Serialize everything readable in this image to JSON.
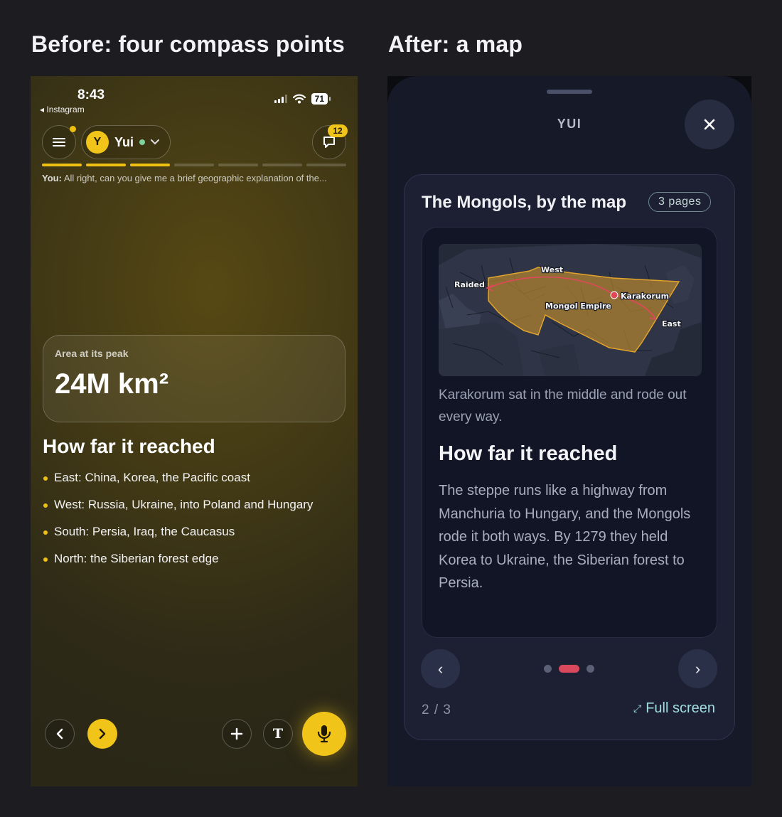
{
  "headings": {
    "before": "Before: four compass points",
    "after": "After: a map"
  },
  "left_phone": {
    "status": {
      "time": "8:43",
      "back_app": "◂ Instagram",
      "battery": "71"
    },
    "user": {
      "avatar_letter": "Y",
      "name": "Yui"
    },
    "chat_badge": "12",
    "progress": {
      "total": 7,
      "filled": 3
    },
    "you_line": {
      "prefix": "You:",
      "text": " All right, can you give me a brief geographic explanation of the..."
    },
    "stat": {
      "label": "Area at its peak",
      "value": "24M km²"
    },
    "section_title": "How far it reached",
    "bullets": [
      "East: China, Korea, the Pacific coast",
      "West: Russia, Ukraine, into Poland and Hungary",
      "South: Persia, Iraq, the Caucasus",
      "North: the Siberian forest edge"
    ],
    "toolbar": {
      "t_label": "T"
    }
  },
  "right_phone": {
    "sheet_title": "YUI",
    "card_title": "The Mongols, by the map",
    "pages_badge": "3 pages",
    "map_labels": {
      "west": "West",
      "raided": "Raided",
      "karakorum": "Karakorum",
      "empire": "Mongol Empire",
      "east": "East"
    },
    "caption": "Karakorum sat in the middle and rode out every way.",
    "section_title": "How far it reached",
    "body": "The steppe runs like a highway from Manchuria to Hungary, and the Mongols rode it both ways. By 1279 they held Korea to Ukraine, the Siberian forest to Persia.",
    "pager": {
      "prev": "‹",
      "next": "›",
      "current_index": 1,
      "count": 3
    },
    "counter": "2 / 3",
    "fullscreen_label": "Full screen",
    "colors": {
      "accent": "#d9485d",
      "empire_fill": "#c9922a",
      "link": "#9fdde0"
    }
  }
}
